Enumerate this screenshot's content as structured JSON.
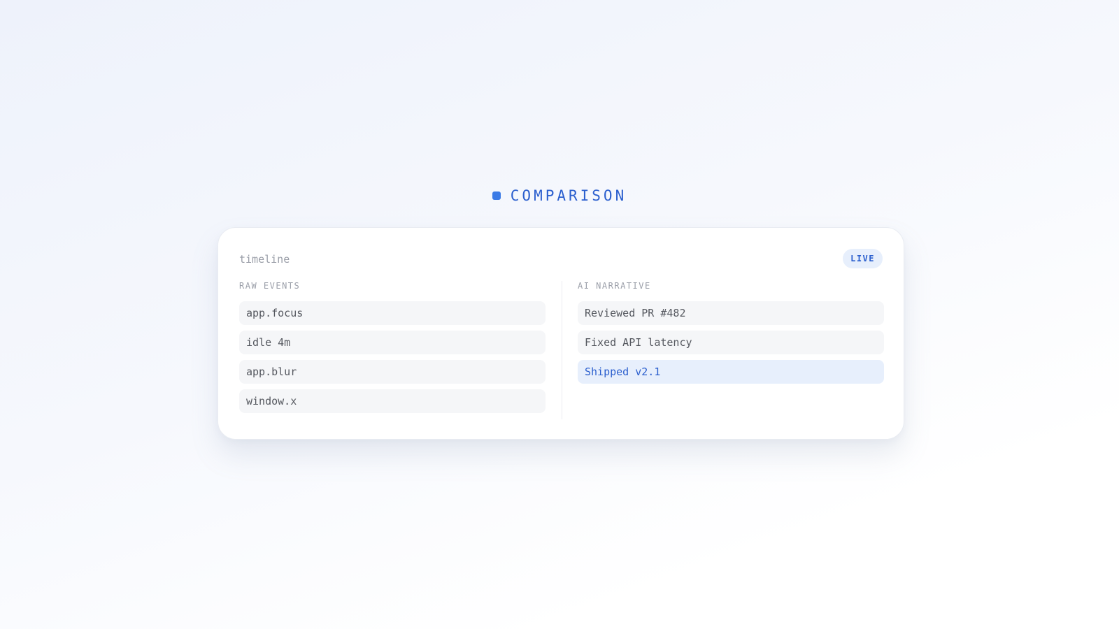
{
  "section": {
    "title": "COMPARISON"
  },
  "card": {
    "title": "timeline",
    "badge": "LIVE",
    "left": {
      "label": "RAW EVENTS",
      "items": [
        "app.focus",
        "idle 4m",
        "app.blur",
        "window.x"
      ]
    },
    "right": {
      "label": "AI NARRATIVE",
      "items": [
        "Reviewed PR #482",
        "Fixed API latency",
        "Shipped v2.1"
      ],
      "highlighted_index": 2
    }
  },
  "colors": {
    "accent": "#2b5fce",
    "accent_bg": "#e7effc",
    "row_bg": "#f5f6f8"
  }
}
